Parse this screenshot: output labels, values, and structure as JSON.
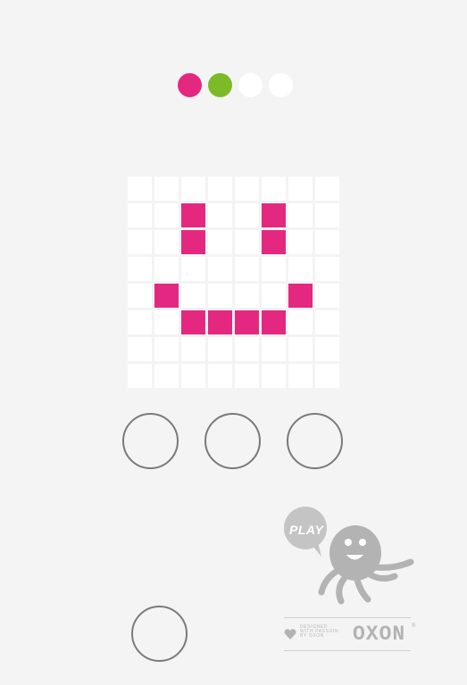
{
  "progress": {
    "dots": [
      {
        "state": "done",
        "color": "#e5287f"
      },
      {
        "state": "current",
        "color": "#7cba27"
      },
      {
        "state": "todo",
        "color": "#ffffff"
      },
      {
        "state": "todo",
        "color": "#ffffff"
      }
    ]
  },
  "grid": {
    "cols": 8,
    "rows": 8,
    "on_color": "#e5287f",
    "off_color": "#ffffff",
    "pattern": [
      "00000000",
      "00100100",
      "00100100",
      "00000000",
      "01000010",
      "00111100",
      "00000000",
      "00000000"
    ]
  },
  "answer_buttons": [
    "option-1",
    "option-2",
    "option-3"
  ],
  "action_button": "action",
  "brand": {
    "bubble_label": "PLAY",
    "credit_line1": "DESIGNED",
    "credit_line2": "WITH PASSION",
    "credit_line3": "BY OXON",
    "logo": "OXON",
    "registered": "®",
    "gray": "#b3b3b3"
  }
}
